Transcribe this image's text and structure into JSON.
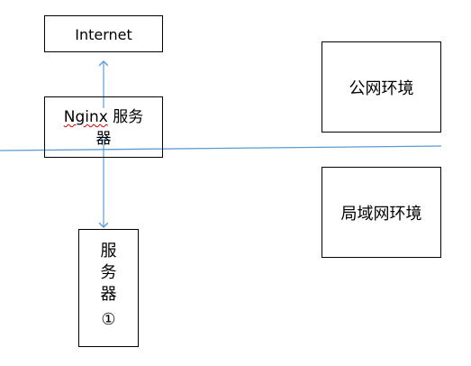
{
  "boxes": {
    "internet": "Internet",
    "nginx_name": "Nginx",
    "nginx_suffix": " 服务",
    "nginx_line2": "器",
    "public_env": "公网环境",
    "lan_env": "局域网环境",
    "server_chars": [
      "服",
      "务",
      "器",
      "①"
    ]
  },
  "colors": {
    "connector": "#5b9bd5",
    "spellcheck": "#d00000",
    "border": "#000000"
  }
}
